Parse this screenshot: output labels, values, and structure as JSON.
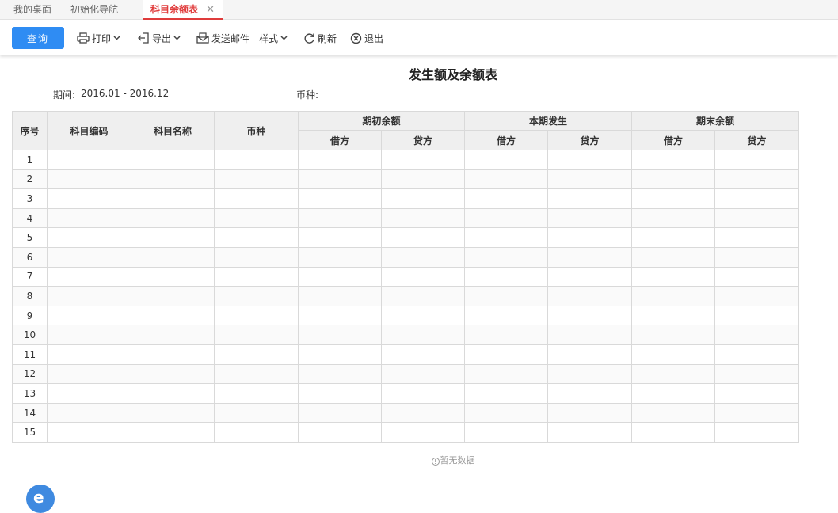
{
  "tabs": {
    "desk": "我的桌面",
    "guide": "初始化导航",
    "active": "科目余额表",
    "close": "✕"
  },
  "toolbar": {
    "query": "查询",
    "print": "打印",
    "export": "导出",
    "send_mail": "发送邮件",
    "style": "样式",
    "refresh": "刷新",
    "exit": "退出"
  },
  "report": {
    "title": "发生额及余额表",
    "period_label": "期间:",
    "period_value": "2016.01 - 2016.12",
    "currency_label": "币种:"
  },
  "table": {
    "headers": {
      "seq": "序号",
      "code": "科目编码",
      "name": "科目名称",
      "currency": "币种",
      "opening": "期初余额",
      "current": "本期发生",
      "closing": "期末余额",
      "debit": "借方",
      "credit": "贷方"
    },
    "rows": [
      "1",
      "2",
      "3",
      "4",
      "5",
      "6",
      "7",
      "8",
      "9",
      "10",
      "11",
      "12",
      "13",
      "14",
      "15"
    ]
  },
  "empty_text": "暂无数据",
  "colors": {
    "accent": "#2f8cf3",
    "active_tab": "#e03c3c",
    "header_bg": "#efefef"
  }
}
